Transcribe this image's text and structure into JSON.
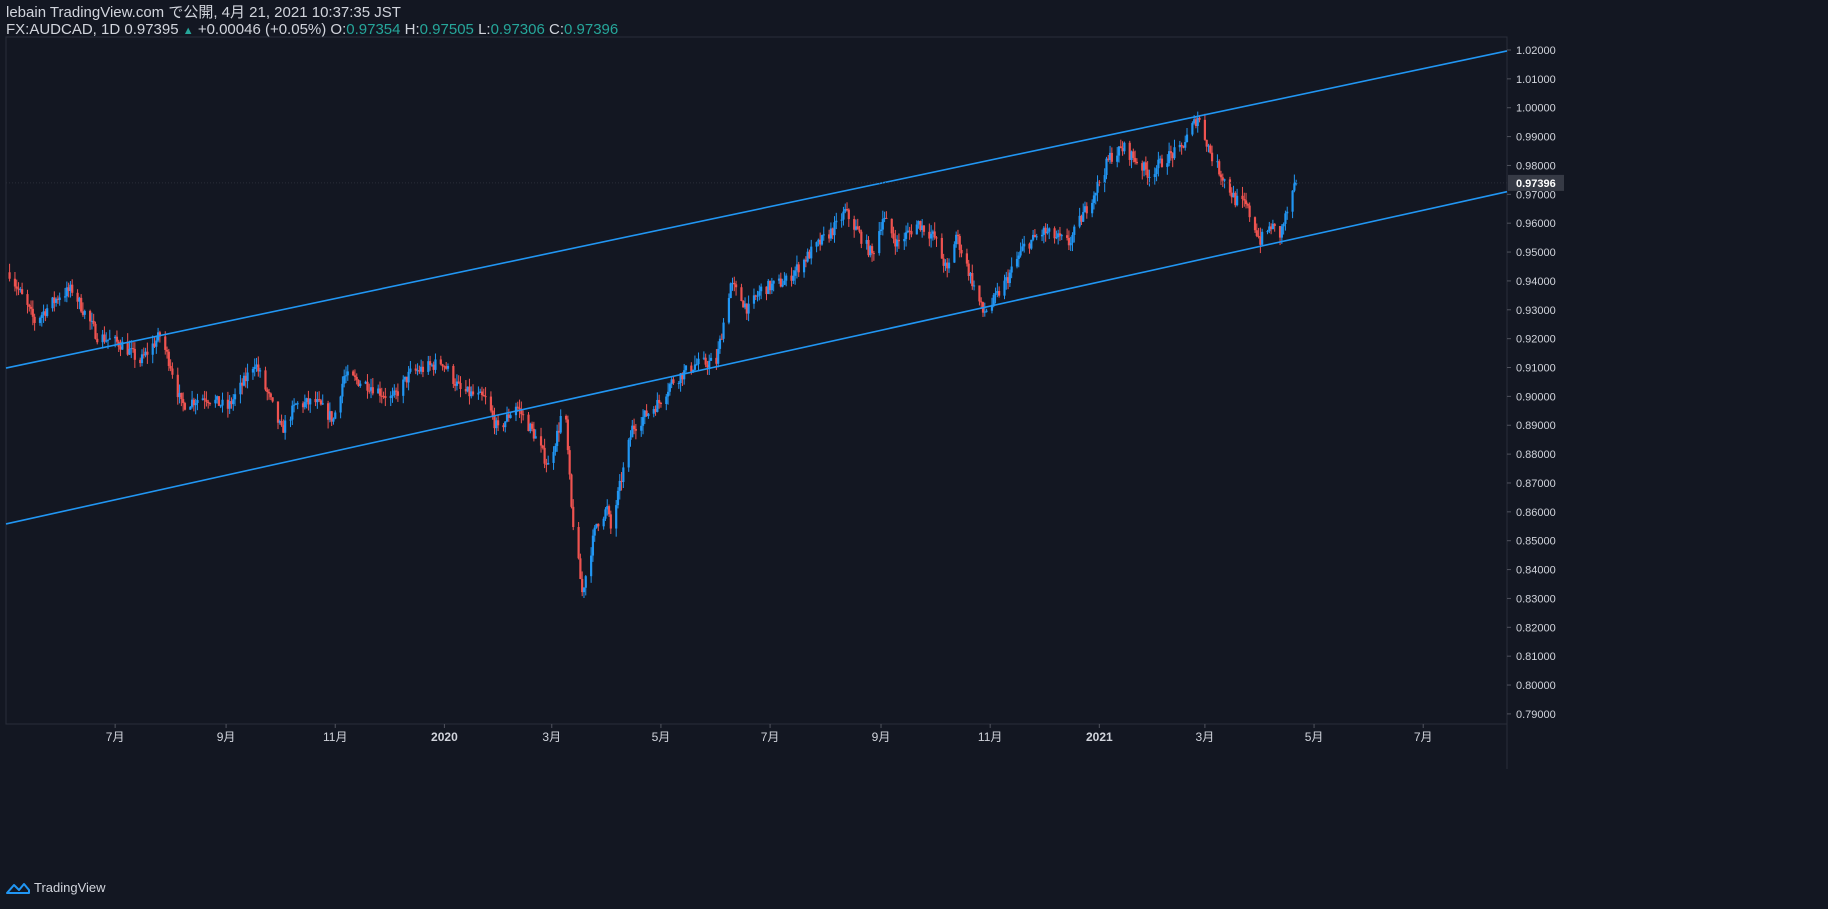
{
  "header": {
    "line1": "lebain TradingView.com で公開, 4月 21, 2021 10:37:35 JST",
    "symbol": "FX:AUDCAD, 1D 0.97395",
    "arrow": "▲",
    "change": "+0.00046 (+0.05%)",
    "o_label": "O:",
    "o_value": "0.97354",
    "h_label": "H:",
    "h_value": "0.97505",
    "l_label": "L:",
    "l_value": "0.97306",
    "c_label": "C:",
    "c_value": "0.97396"
  },
  "footer": {
    "brand": "TradingView"
  },
  "colors": {
    "background": "#131722",
    "up": "#2196f3",
    "down": "#ef5350",
    "channel": "#2196f3",
    "text": "#d1d4dc"
  },
  "chart_data": {
    "type": "candlestick",
    "symbol": "FX:AUDCAD",
    "interval": "1D",
    "last_price_label": "0.97396",
    "ylim": [
      0.7865,
      1.0245
    ],
    "y_ticks": [
      "0.79000",
      "0.80000",
      "0.81000",
      "0.82000",
      "0.83000",
      "0.84000",
      "0.85000",
      "0.86000",
      "0.87000",
      "0.88000",
      "0.89000",
      "0.90000",
      "0.91000",
      "0.92000",
      "0.93000",
      "0.94000",
      "0.95000",
      "0.96000",
      "0.97000",
      "0.98000",
      "0.99000",
      "1.00000",
      "1.01000",
      "1.02000"
    ],
    "x_ticks": [
      {
        "label": "7月",
        "date": "2019-07-01"
      },
      {
        "label": "9月",
        "date": "2019-09-01"
      },
      {
        "label": "11月",
        "date": "2019-11-01"
      },
      {
        "label": "2020",
        "date": "2020-01-01"
      },
      {
        "label": "3月",
        "date": "2020-03-01"
      },
      {
        "label": "5月",
        "date": "2020-05-01"
      },
      {
        "label": "7月",
        "date": "2020-07-01"
      },
      {
        "label": "9月",
        "date": "2020-09-01"
      },
      {
        "label": "11月",
        "date": "2020-11-01"
      },
      {
        "label": "2021",
        "date": "2021-01-01"
      },
      {
        "label": "3月",
        "date": "2021-03-01"
      },
      {
        "label": "5月",
        "date": "2021-05-01"
      },
      {
        "label": "7月",
        "date": "2021-07-01"
      }
    ],
    "price_path": [
      [
        "2019-05-03",
        0.943
      ],
      [
        "2019-05-17",
        0.926
      ],
      [
        "2019-05-31",
        0.935
      ],
      [
        "2019-06-07",
        0.937
      ],
      [
        "2019-06-21",
        0.921
      ],
      [
        "2019-07-05",
        0.918
      ],
      [
        "2019-07-15",
        0.912
      ],
      [
        "2019-07-26",
        0.921
      ],
      [
        "2019-08-01",
        0.911
      ],
      [
        "2019-08-07",
        0.897
      ],
      [
        "2019-08-20",
        0.9
      ],
      [
        "2019-09-02",
        0.896
      ],
      [
        "2019-09-12",
        0.906
      ],
      [
        "2019-09-17",
        0.912
      ],
      [
        "2019-09-26",
        0.898
      ],
      [
        "2019-10-02",
        0.888
      ],
      [
        "2019-10-10",
        0.897
      ],
      [
        "2019-10-21",
        0.898
      ],
      [
        "2019-10-31",
        0.892
      ],
      [
        "2019-11-06",
        0.907
      ],
      [
        "2019-11-20",
        0.904
      ],
      [
        "2019-12-03",
        0.899
      ],
      [
        "2019-12-13",
        0.908
      ],
      [
        "2019-12-31",
        0.912
      ],
      [
        "2020-01-10",
        0.902
      ],
      [
        "2020-01-24",
        0.899
      ],
      [
        "2020-01-31",
        0.888
      ],
      [
        "2020-02-10",
        0.897
      ],
      [
        "2020-02-20",
        0.887
      ],
      [
        "2020-02-28",
        0.876
      ],
      [
        "2020-03-05",
        0.889
      ],
      [
        "2020-03-08",
        0.9
      ],
      [
        "2020-03-12",
        0.861
      ],
      [
        "2020-03-18",
        0.832
      ],
      [
        "2020-03-26",
        0.856
      ],
      [
        "2020-04-01",
        0.861
      ],
      [
        "2020-04-03",
        0.854
      ],
      [
        "2020-04-15",
        0.889
      ],
      [
        "2020-04-30",
        0.898
      ],
      [
        "2020-05-07",
        0.905
      ],
      [
        "2020-05-20",
        0.911
      ],
      [
        "2020-06-01",
        0.912
      ],
      [
        "2020-06-09",
        0.939
      ],
      [
        "2020-06-19",
        0.93
      ],
      [
        "2020-06-26",
        0.937
      ],
      [
        "2020-07-10",
        0.94
      ],
      [
        "2020-07-24",
        0.95
      ],
      [
        "2020-08-07",
        0.959
      ],
      [
        "2020-08-12",
        0.964
      ],
      [
        "2020-08-20",
        0.956
      ],
      [
        "2020-08-27",
        0.949
      ],
      [
        "2020-09-02",
        0.962
      ],
      [
        "2020-09-10",
        0.953
      ],
      [
        "2020-09-22",
        0.96
      ],
      [
        "2020-10-01",
        0.955
      ],
      [
        "2020-10-08",
        0.943
      ],
      [
        "2020-10-13",
        0.956
      ],
      [
        "2020-10-28",
        0.929
      ],
      [
        "2020-11-02",
        0.932
      ],
      [
        "2020-11-10",
        0.94
      ],
      [
        "2020-11-20",
        0.952
      ],
      [
        "2020-12-01",
        0.957
      ],
      [
        "2020-12-15",
        0.953
      ],
      [
        "2020-12-31",
        0.973
      ],
      [
        "2021-01-07",
        0.983
      ],
      [
        "2021-01-15",
        0.986
      ],
      [
        "2021-01-29",
        0.977
      ],
      [
        "2021-02-08",
        0.983
      ],
      [
        "2021-02-15",
        0.985
      ],
      [
        "2021-02-25",
        0.997
      ],
      [
        "2021-03-01",
        0.99
      ],
      [
        "2021-03-05",
        0.983
      ],
      [
        "2021-03-18",
        0.968
      ],
      [
        "2021-03-24",
        0.966
      ],
      [
        "2021-04-01",
        0.954
      ],
      [
        "2021-04-07",
        0.959
      ],
      [
        "2021-04-12",
        0.956
      ],
      [
        "2021-04-21",
        0.974
      ]
    ],
    "channel_lines": [
      {
        "name": "upper",
        "from": [
          "2019-05-01",
          0.9098
        ],
        "to": [
          "2021-05-06",
          1.0062
        ]
      },
      {
        "name": "lower",
        "from": [
          "2019-05-01",
          0.8558
        ],
        "to": [
          "2021-05-06",
          0.9568
        ]
      }
    ]
  }
}
